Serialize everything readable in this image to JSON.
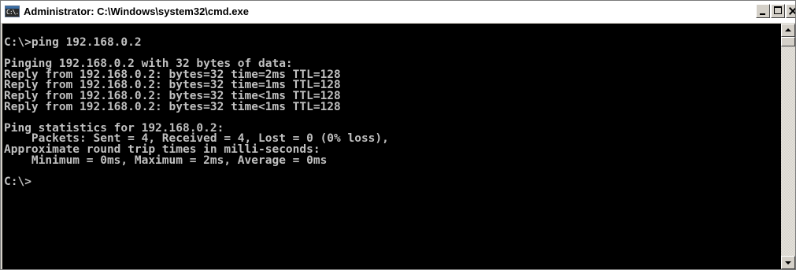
{
  "window": {
    "title": "Administrator: C:\\Windows\\system32\\cmd.exe",
    "icon_glyph": "C:\\."
  },
  "console": {
    "lines": [
      "C:\\>ping 192.168.0.2",
      "",
      "Pinging 192.168.0.2 with 32 bytes of data:",
      "Reply from 192.168.0.2: bytes=32 time=2ms TTL=128",
      "Reply from 192.168.0.2: bytes=32 time=1ms TTL=128",
      "Reply from 192.168.0.2: bytes=32 time<1ms TTL=128",
      "Reply from 192.168.0.2: bytes=32 time<1ms TTL=128",
      "",
      "Ping statistics for 192.168.0.2:",
      "    Packets: Sent = 4, Received = 4, Lost = 0 (0% loss),",
      "Approximate round trip times in milli-seconds:",
      "    Minimum = 0ms, Maximum = 2ms, Average = 0ms",
      "",
      "C:\\>"
    ]
  },
  "colors": {
    "console_background": "#000000",
    "console_text": "#c0c0c0",
    "titlebar_background": "#ffffff",
    "chrome": "#d4d0c8"
  },
  "icons": {
    "window_icon": "cmd-icon",
    "minimize": "minimize-icon",
    "maximize": "maximize-icon",
    "close": "close-icon",
    "scroll_up": "arrow-up-icon",
    "scroll_down": "arrow-down-icon"
  }
}
